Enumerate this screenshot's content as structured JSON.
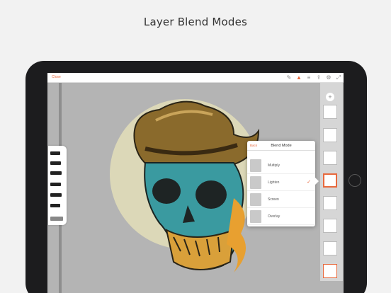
{
  "headline": "Layer Blend Modes",
  "app": {
    "close_label": "Close"
  },
  "toolbar": {
    "icons": [
      "brush-icon",
      "layers-icon",
      "share-icon",
      "settings-icon",
      "fullscreen-icon"
    ]
  },
  "blend_popup": {
    "back_label": "Back",
    "title": "Blend Mode",
    "modes": [
      {
        "label": "Multiply",
        "selected": false
      },
      {
        "label": "Lighten",
        "selected": true
      },
      {
        "label": "Screen",
        "selected": false
      },
      {
        "label": "Overlay",
        "selected": false
      }
    ]
  },
  "colors": {
    "accent": "#e8693d",
    "canvas": "#b4b4b4",
    "sun": "#dcd8b8"
  }
}
